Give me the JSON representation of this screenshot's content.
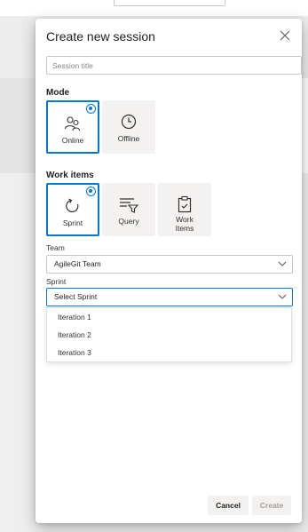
{
  "dialog": {
    "title": "Create new session",
    "session_title_placeholder": "Session title",
    "mode": {
      "label": "Mode",
      "options": [
        {
          "label": "Online",
          "icon": "people-icon",
          "selected": true
        },
        {
          "label": "Offline",
          "icon": "clock-icon",
          "selected": false
        }
      ]
    },
    "work_items": {
      "label": "Work items",
      "options": [
        {
          "label": "Sprint",
          "icon": "sprint-cycle-icon",
          "selected": true
        },
        {
          "label": "Query",
          "icon": "filter-list-icon",
          "selected": false
        },
        {
          "label": "Work\nItems",
          "label_line1": "Work",
          "label_line2": "Items",
          "icon": "clipboard-icon",
          "selected": false
        }
      ]
    },
    "team": {
      "label": "Team",
      "value": "AgileGit Team"
    },
    "sprint": {
      "label": "Sprint",
      "value": "Select Sprint",
      "options": [
        "Iteration 1",
        "Iteration 2",
        "Iteration 3"
      ]
    },
    "buttons": {
      "cancel": "Cancel",
      "create": "Create"
    }
  },
  "colors": {
    "accent": "#0078d4",
    "tile_bg": "#f3f2f1",
    "border": "#c8c6c4"
  }
}
